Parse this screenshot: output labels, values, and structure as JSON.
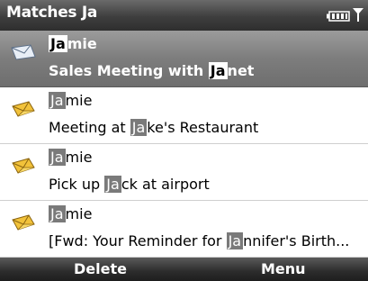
{
  "header": {
    "title": "Matches Ja",
    "battery_icon": "battery-icon",
    "signal_icon": "signal-icon"
  },
  "messages": [
    {
      "icon": "envelope-icon",
      "sender_match": "Ja",
      "sender_rest": "mie",
      "subject_pre": "Sales Meeting with ",
      "subject_match": "Ja",
      "subject_post": "net",
      "selected": true
    },
    {
      "icon": "meeting-envelope-icon",
      "sender_match": "Ja",
      "sender_rest": "mie",
      "subject_pre": "Meeting at ",
      "subject_match": "Ja",
      "subject_post": "ke's Restaurant",
      "selected": false
    },
    {
      "icon": "meeting-envelope-icon",
      "sender_match": "Ja",
      "sender_rest": "mie",
      "subject_pre": "Pick up ",
      "subject_match": "Ja",
      "subject_post": "ck at airport",
      "selected": false
    },
    {
      "icon": "meeting-envelope-icon",
      "sender_match": "Ja",
      "sender_rest": "mie",
      "subject_pre": "[Fwd: Your Reminder for ",
      "subject_match": "Ja",
      "subject_post": "nnifer's Birth...",
      "selected": false
    }
  ],
  "softkeys": {
    "left": "Delete",
    "right": "Menu"
  },
  "colors": {
    "title_bar": "#3e3e3e",
    "selected_row": "#7d7d7d",
    "highlight": "#7a7a7a"
  }
}
